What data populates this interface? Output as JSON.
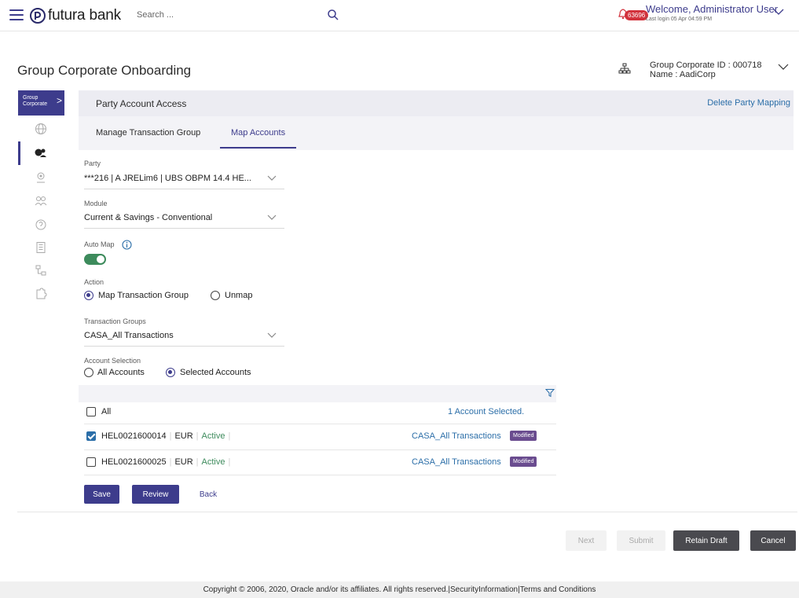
{
  "header": {
    "brand": "futura bank",
    "search_placeholder": "Search ...",
    "notification_count": "63696",
    "welcome": "Welcome, Administrator User",
    "last_login": "Last login 05 Apr 04:59 PM"
  },
  "page": {
    "title": "Group Corporate Onboarding",
    "corporate_id": "Group Corporate ID : 000718",
    "corporate_name": "Name : AadiCorp"
  },
  "rail": {
    "head_line1": "Group",
    "head_line2": "Corporate",
    "head_arrow": ">"
  },
  "card": {
    "title": "Party Account Access",
    "delete_link": "Delete Party Mapping",
    "tabs": [
      {
        "label": "Manage Transaction Group",
        "active": false
      },
      {
        "label": "Map Accounts",
        "active": true
      }
    ]
  },
  "form": {
    "party_label": "Party",
    "party_value": "***216 | A JRELim6 | UBS OBPM 14.4 HE...",
    "module_label": "Module",
    "module_value": "Current & Savings - Conventional",
    "automap_label": "Auto Map",
    "automap_on": true,
    "action_label": "Action",
    "action_options": [
      "Map Transaction Group",
      "Unmap"
    ],
    "action_selected": "Map Transaction Group",
    "txn_groups_label": "Transaction Groups",
    "txn_groups_value": "CASA_All Transactions",
    "account_selection_label": "Account Selection",
    "account_selection_options": [
      "All Accounts",
      "Selected Accounts"
    ],
    "account_selection_selected": "Selected Accounts"
  },
  "accounts": {
    "all_label": "All",
    "selected_summary": "1 Account Selected.",
    "rows": [
      {
        "number": "HEL0021600014",
        "currency": "EUR",
        "status": "Active",
        "group": "CASA_All Transactions",
        "badge": "Modified",
        "checked": true
      },
      {
        "number": "HEL0021600025",
        "currency": "EUR",
        "status": "Active",
        "group": "CASA_All Transactions",
        "badge": "Modified",
        "checked": false
      }
    ]
  },
  "actions": {
    "save": "Save",
    "review": "Review",
    "back": "Back",
    "next": "Next",
    "submit": "Submit",
    "retain_draft": "Retain Draft",
    "cancel": "Cancel"
  },
  "footer": {
    "text": "Copyright © 2006, 2020, Oracle and/or its affiliates. All rights reserved.|SecurityInformation|Terms and Conditions"
  },
  "colors": {
    "primary": "#3d3c8c",
    "link": "#2b6ea8",
    "active_status": "#3d8b5c",
    "modified_badge": "#6a4c8f",
    "notification": "#d2323c"
  }
}
